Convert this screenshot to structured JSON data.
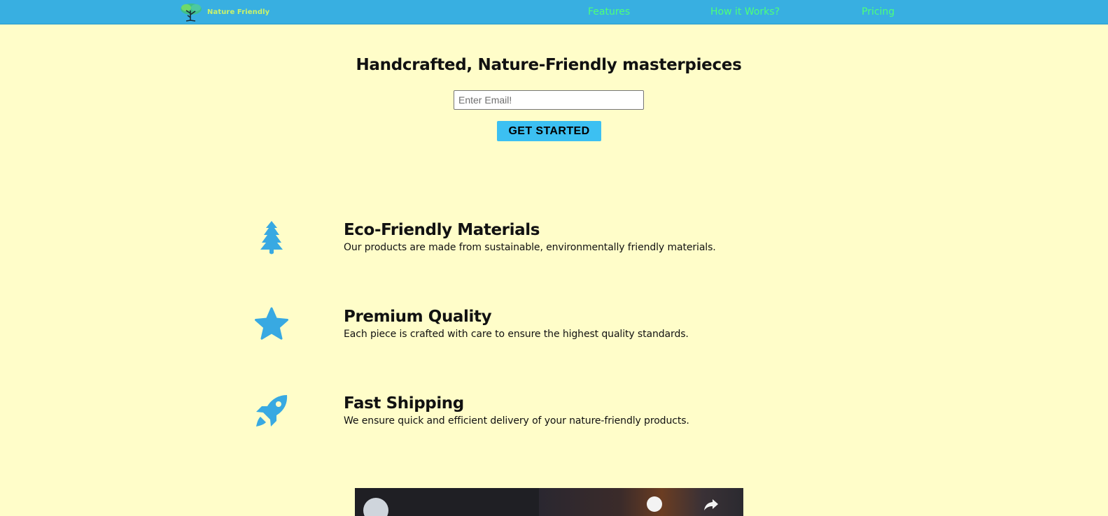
{
  "header": {
    "logo_text": "Nature Friendly",
    "nav": [
      {
        "label": "Features"
      },
      {
        "label": "How it Works?"
      },
      {
        "label": "Pricing"
      }
    ]
  },
  "hero": {
    "title": "Handcrafted, Nature-Friendly masterpieces",
    "email_placeholder": "Enter Email!",
    "email_value": "",
    "cta_label": "GET STARTED"
  },
  "features": [
    {
      "icon": "tree-icon",
      "title": "Eco-Friendly Materials",
      "description": "Our products are made from sustainable, environmentally friendly materials."
    },
    {
      "icon": "star-icon",
      "title": "Premium Quality",
      "description": "Each piece is crafted with care to ensure the highest quality standards."
    },
    {
      "icon": "rocket-icon",
      "title": "Fast Shipping",
      "description": "We ensure quick and efficient delivery of your nature-friendly products."
    }
  ],
  "video": {
    "icons": [
      "avatar",
      "clock-icon",
      "share-icon"
    ]
  },
  "colors": {
    "page_background": "#fffdc9",
    "header_background": "#38afe1",
    "nav_link": "#4dff7a",
    "logo_text": "#c9f26a",
    "button_background": "#3cc0f2",
    "icon": "#38a9e2"
  }
}
